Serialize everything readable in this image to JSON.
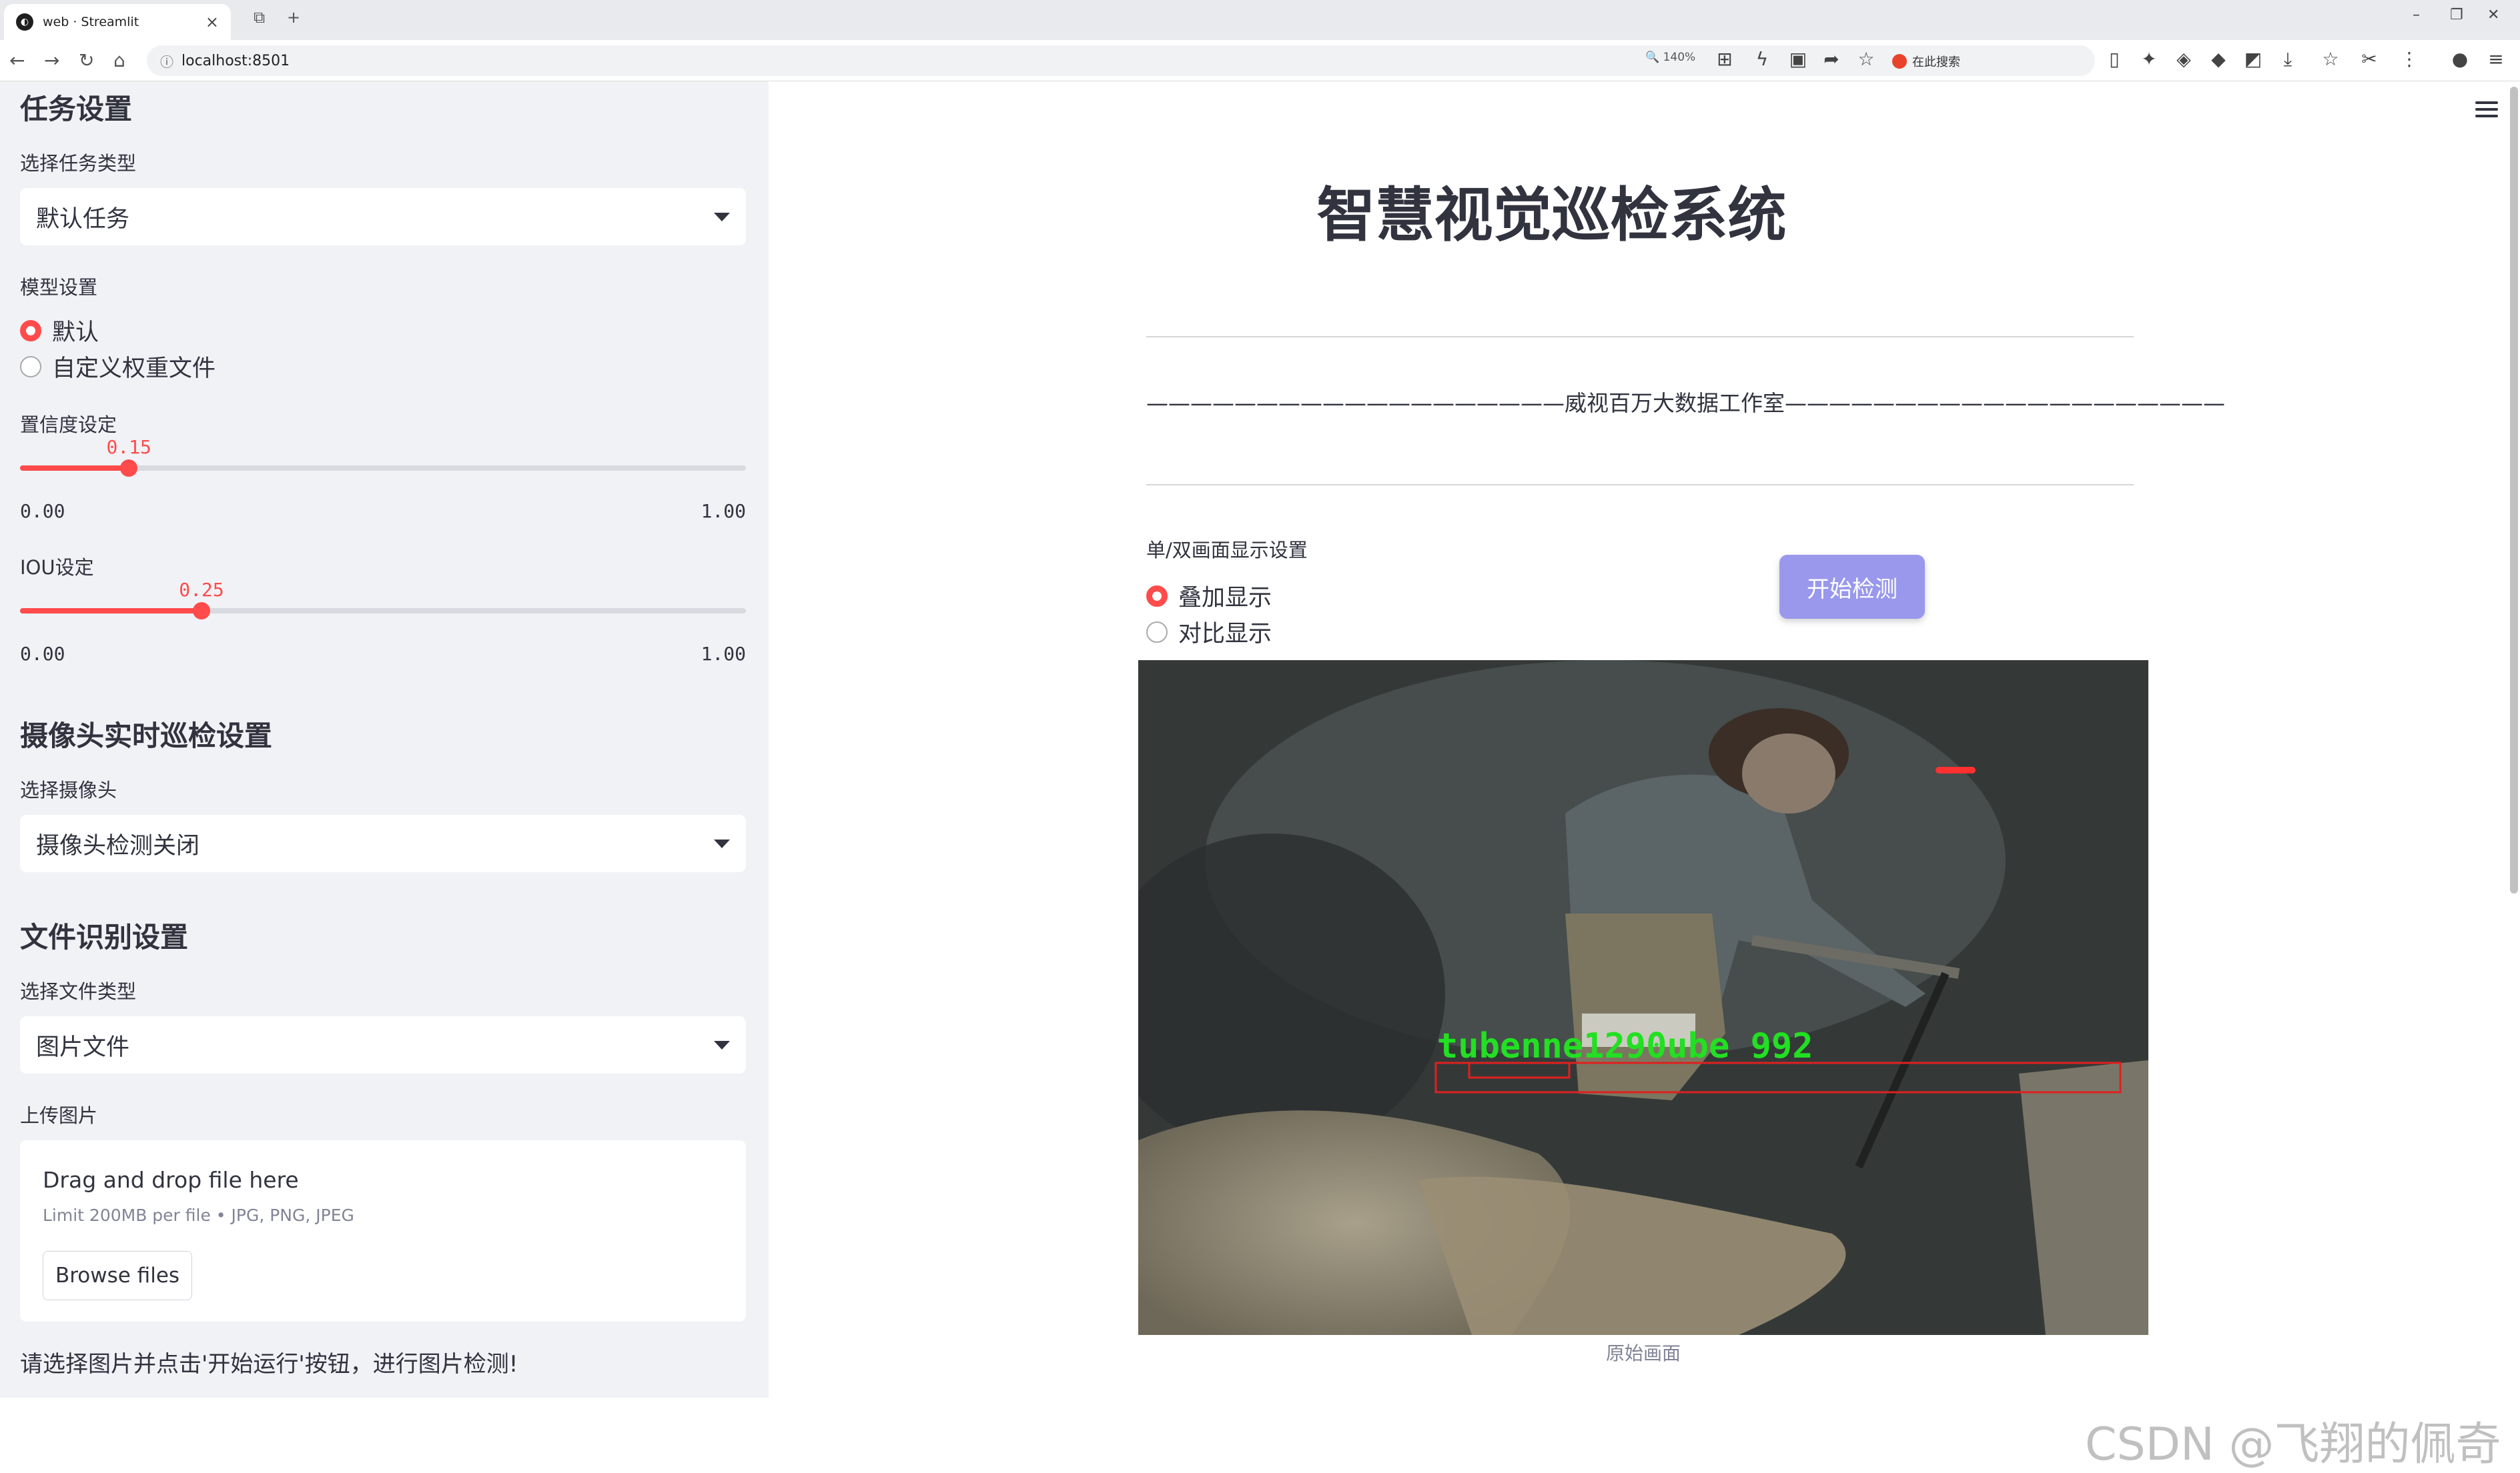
{
  "browser": {
    "tab_title": "web · Streamlit",
    "url": "localhost:8501",
    "zoom": "140%",
    "search_label": "在此搜索"
  },
  "sidebar": {
    "task_heading": "任务设置",
    "task_type_label": "选择任务类型",
    "task_type_value": "默认任务",
    "model_label": "模型设置",
    "model_options": [
      "默认",
      "自定义权重文件"
    ],
    "model_selected": "默认",
    "conf_label": "置信度设定",
    "conf_value": "0.15",
    "conf_min": "0.00",
    "conf_max": "1.00",
    "conf_fraction": 0.15,
    "iou_label": "IOU设定",
    "iou_value": "0.25",
    "iou_min": "0.00",
    "iou_max": "1.00",
    "iou_fraction": 0.25,
    "camera_heading": "摄像头实时巡检设置",
    "camera_label": "选择摄像头",
    "camera_value": "摄像头检测关闭",
    "file_heading": "文件识别设置",
    "file_type_label": "选择文件类型",
    "file_type_value": "图片文件",
    "upload_label": "上传图片",
    "upload_drag": "Drag and drop file here",
    "upload_limit": "Limit 200MB per file • JPG, PNG, JPEG",
    "upload_button": "Browse files",
    "instruction": "请选择图片并点击'开始运行'按钮，进行图片检测!"
  },
  "main": {
    "title": "智慧视觉巡检系统",
    "studio_line": "———————————————————威视百万大数据工作室————————————————————",
    "display_label": "单/双画面显示设置",
    "display_options": [
      "叠加显示",
      "对比显示"
    ],
    "display_selected": "叠加显示",
    "run_button": "开始检测",
    "detection_text": "tubenne1290ube 992",
    "image_caption": "原始画面",
    "watermark": "CSDN @飞翔的佩奇"
  },
  "colors": {
    "accent": "#ff4b4b",
    "sidebar_bg": "#f0f2f6",
    "run_button_bg": "#9a98ec",
    "detection_box": "#e02020",
    "detection_text": "#22e022"
  }
}
